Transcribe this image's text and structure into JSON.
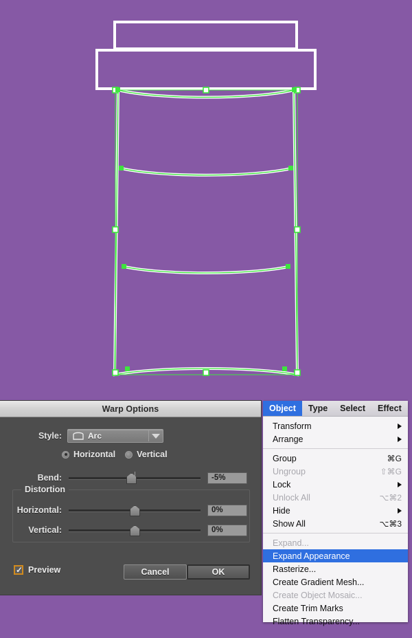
{
  "canvas": {
    "background_color": "#8659a5",
    "artwork_name": "warped-coffee-cup",
    "stroke_color": "#ffffff",
    "selection_color": "#3ee53e",
    "description": "Warped coffee cup outline artwork with Arc warp applied, anchor points visible"
  },
  "warp_dialog": {
    "title": "Warp Options",
    "style": {
      "label": "Style:",
      "value": "Arc",
      "icon": "arc-shape-icon"
    },
    "orientation": {
      "horizontal_label": "Horizontal",
      "vertical_label": "Vertical",
      "selected": "Horizontal"
    },
    "bend": {
      "label": "Bend:",
      "value": "-5%",
      "percent": -5,
      "min": -100,
      "max": 100
    },
    "distortion": {
      "legend": "Distortion",
      "horizontal": {
        "label": "Horizontal:",
        "value": "0%",
        "percent": 0,
        "min": -100,
        "max": 100
      },
      "vertical": {
        "label": "Vertical:",
        "value": "0%",
        "percent": 0,
        "min": -100,
        "max": 100
      }
    },
    "preview": {
      "label": "Preview",
      "checked": true,
      "check_glyph": "✓",
      "accent_color": "#d08a1e"
    },
    "cancel_label": "Cancel",
    "ok_label": "OK"
  },
  "object_menu": {
    "menubar": [
      {
        "label": "Object",
        "active": true
      },
      {
        "label": "Type",
        "active": false
      },
      {
        "label": "Select",
        "active": false
      },
      {
        "label": "Effect",
        "active": false
      }
    ],
    "highlight_color": "#2f6fe0",
    "items": [
      {
        "label": "Transform",
        "shortcut": "",
        "submenu": true,
        "disabled": false,
        "selected": false
      },
      {
        "label": "Arrange",
        "shortcut": "",
        "submenu": true,
        "disabled": false,
        "selected": false
      },
      {
        "separator": true
      },
      {
        "label": "Group",
        "shortcut": "⌘G",
        "submenu": false,
        "disabled": false,
        "selected": false
      },
      {
        "label": "Ungroup",
        "shortcut": "⇧⌘G",
        "submenu": false,
        "disabled": true,
        "selected": false
      },
      {
        "label": "Lock",
        "shortcut": "",
        "submenu": true,
        "disabled": false,
        "selected": false
      },
      {
        "label": "Unlock All",
        "shortcut": "⌥⌘2",
        "submenu": false,
        "disabled": true,
        "selected": false
      },
      {
        "label": "Hide",
        "shortcut": "",
        "submenu": true,
        "disabled": false,
        "selected": false
      },
      {
        "label": "Show All",
        "shortcut": "⌥⌘3",
        "submenu": false,
        "disabled": false,
        "selected": false
      },
      {
        "separator": true
      },
      {
        "label": "Expand...",
        "shortcut": "",
        "submenu": false,
        "disabled": true,
        "selected": false
      },
      {
        "label": "Expand Appearance",
        "shortcut": "",
        "submenu": false,
        "disabled": false,
        "selected": true
      },
      {
        "label": "Rasterize...",
        "shortcut": "",
        "submenu": false,
        "disabled": false,
        "selected": false
      },
      {
        "label": "Create Gradient Mesh...",
        "shortcut": "",
        "submenu": false,
        "disabled": false,
        "selected": false
      },
      {
        "label": "Create Object Mosaic...",
        "shortcut": "",
        "submenu": false,
        "disabled": true,
        "selected": false
      },
      {
        "label": "Create Trim Marks",
        "shortcut": "",
        "submenu": false,
        "disabled": false,
        "selected": false
      },
      {
        "label": "Flatten Transparency...",
        "shortcut": "",
        "submenu": false,
        "disabled": false,
        "selected": false
      }
    ]
  }
}
